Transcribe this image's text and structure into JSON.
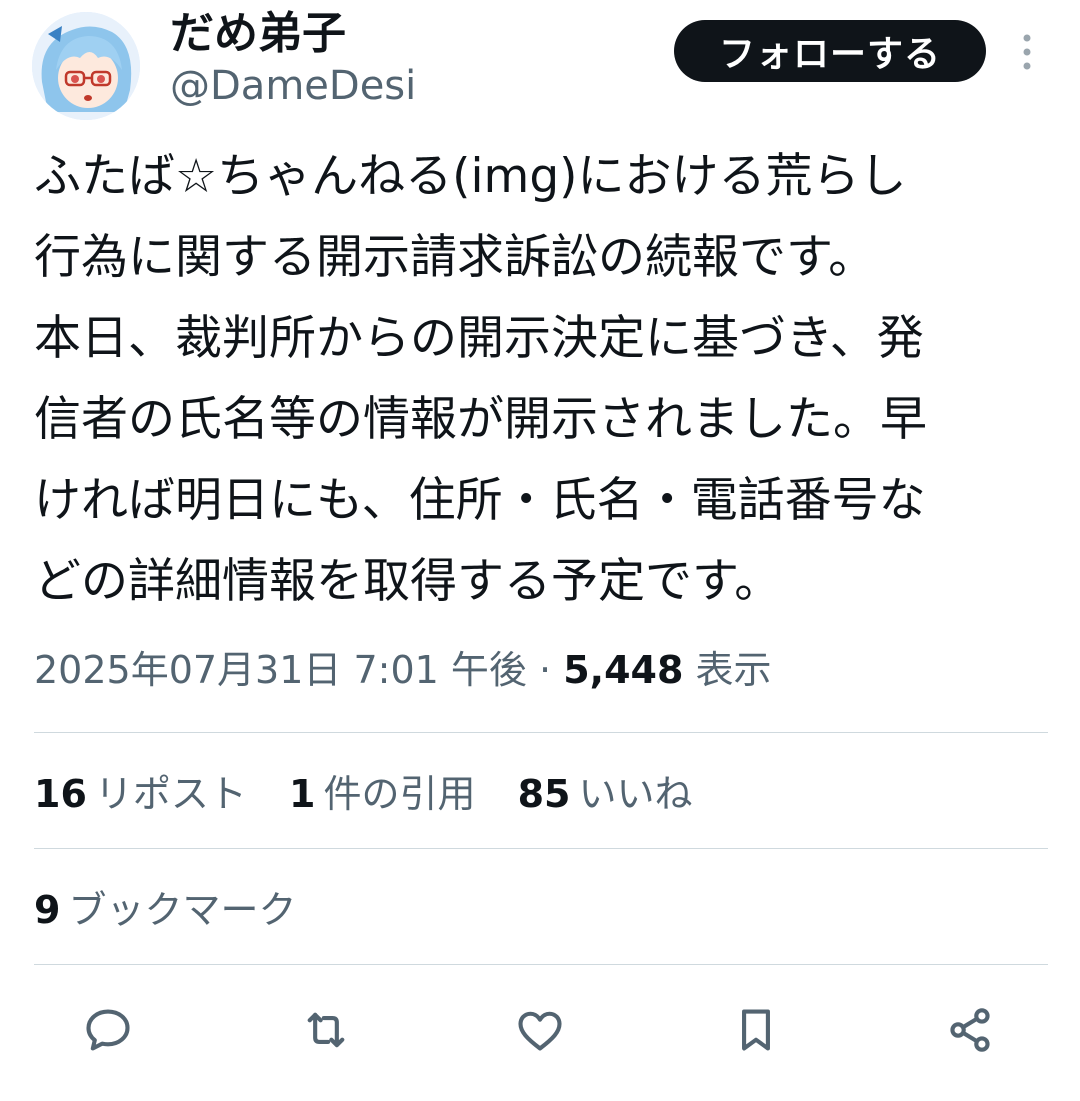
{
  "author": {
    "display_name": "だめ弟子",
    "handle": "@DameDesi"
  },
  "follow_button_label": "フォローする",
  "tweet": {
    "lines": [
      "ふたば☆ちゃんねる(img)における荒らし",
      "行為に関する開示請求訴訟の続報です。",
      "本日、裁判所からの開示決定に基づき、発",
      "信者の氏名等の情報が開示されました。早",
      "ければ明日にも、住所・氏名・電話番号な",
      "どの詳細情報を取得する予定です。"
    ]
  },
  "meta": {
    "datetime": "2025年07月31日 7:01 午後",
    "separator": "·",
    "views_count": "5,448",
    "views_label": "表示"
  },
  "stats": {
    "reposts_count": "16",
    "reposts_label": "リポスト",
    "quotes_count": "1",
    "quotes_label": "件の引用",
    "likes_count": "85",
    "likes_label": "いいね",
    "bookmarks_count": "9",
    "bookmarks_label": "ブックマーク"
  },
  "actions": [
    "reply-icon",
    "repost-icon",
    "like-icon",
    "bookmark-icon",
    "share-icon"
  ],
  "colors": {
    "text_primary": "#0f1419",
    "text_secondary": "#536471",
    "divider": "#cfd9de",
    "button_bg": "#0f1419",
    "button_text": "#ffffff"
  }
}
